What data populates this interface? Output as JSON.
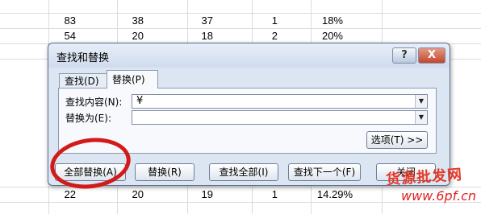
{
  "sheet": {
    "top_rows": [
      [
        "83",
        "38",
        "37",
        "1",
        "18%"
      ],
      [
        "54",
        "20",
        "18",
        "2",
        "20%"
      ]
    ],
    "bottom_row": [
      "22",
      "20",
      "19",
      "1",
      "14.29%"
    ]
  },
  "dialog": {
    "title": "查找和替换",
    "help_label": "?",
    "close_label": "X",
    "tabs": [
      {
        "label": "查找(D)"
      },
      {
        "label": "替换(P)"
      }
    ],
    "find_label": "查找内容(N):",
    "find_value": "¥",
    "replace_label": "替换为(E):",
    "replace_value": "",
    "options_button": "选项(T) >>",
    "buttons": {
      "replace_all": "全部替换(A)",
      "replace": "替换(R)",
      "find_all": "查找全部(I)",
      "find_next": "查找下一个(F)",
      "close": "关闭"
    }
  },
  "watermark": {
    "line1": "货源批发网",
    "line2": "www.6pf.cn"
  },
  "colors": {
    "annotation_circle": "#d21a1a",
    "dialog_bg": "#dce6f2",
    "close_button": "#c4452d"
  }
}
